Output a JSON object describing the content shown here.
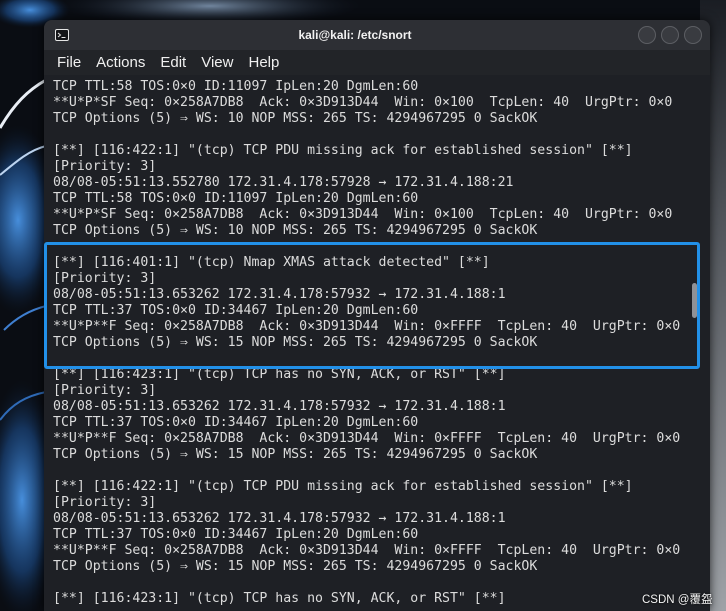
{
  "window": {
    "title": "kali@kali: /etc/snort"
  },
  "icons": {
    "window": "terminal-icon"
  },
  "menu": {
    "items": [
      "File",
      "Actions",
      "Edit",
      "View",
      "Help"
    ]
  },
  "terminal": {
    "lines": [
      "TCP TTL:58 TOS:0×0 ID:11097 IpLen:20 DgmLen:60",
      "**U*P*SF Seq: 0×258A7DB8  Ack: 0×3D913D44  Win: 0×100  TcpLen: 40  UrgPtr: 0×0",
      "TCP Options (5) ⇒ WS: 10 NOP MSS: 265 TS: 4294967295 0 SackOK",
      "",
      "[**] [116:422:1] \"(tcp) TCP PDU missing ack for established session\" [**]",
      "[Priority: 3]",
      "08/08-05:51:13.552780 172.31.4.178:57928 → 172.31.4.188:21",
      "TCP TTL:58 TOS:0×0 ID:11097 IpLen:20 DgmLen:60",
      "**U*P*SF Seq: 0×258A7DB8  Ack: 0×3D913D44  Win: 0×100  TcpLen: 40  UrgPtr: 0×0",
      "TCP Options (5) ⇒ WS: 10 NOP MSS: 265 TS: 4294967295 0 SackOK",
      "",
      "[**] [116:401:1] \"(tcp) Nmap XMAS attack detected\" [**]",
      "[Priority: 3]",
      "08/08-05:51:13.653262 172.31.4.178:57932 → 172.31.4.188:1",
      "TCP TTL:37 TOS:0×0 ID:34467 IpLen:20 DgmLen:60",
      "**U*P**F Seq: 0×258A7DB8  Ack: 0×3D913D44  Win: 0×FFFF  TcpLen: 40  UrgPtr: 0×0",
      "TCP Options (5) ⇒ WS: 15 NOP MSS: 265 TS: 4294967295 0 SackOK",
      "",
      "[**] [116:423:1] \"(tcp) TCP has no SYN, ACK, or RST\" [**]",
      "[Priority: 3]",
      "08/08-05:51:13.653262 172.31.4.178:57932 → 172.31.4.188:1",
      "TCP TTL:37 TOS:0×0 ID:34467 IpLen:20 DgmLen:60",
      "**U*P**F Seq: 0×258A7DB8  Ack: 0×3D913D44  Win: 0×FFFF  TcpLen: 40  UrgPtr: 0×0",
      "TCP Options (5) ⇒ WS: 15 NOP MSS: 265 TS: 4294967295 0 SackOK",
      "",
      "[**] [116:422:1] \"(tcp) TCP PDU missing ack for established session\" [**]",
      "[Priority: 3]",
      "08/08-05:51:13.653262 172.31.4.178:57932 → 172.31.4.188:1",
      "TCP TTL:37 TOS:0×0 ID:34467 IpLen:20 DgmLen:60",
      "**U*P**F Seq: 0×258A7DB8  Ack: 0×3D913D44  Win: 0×FFFF  TcpLen: 40  UrgPtr: 0×0",
      "TCP Options (5) ⇒ WS: 15 NOP MSS: 265 TS: 4294967295 0 SackOK",
      "",
      "[**] [116:423:1] \"(tcp) TCP has no SYN, ACK, or RST\" [**]"
    ],
    "scroll_position": 0.41
  },
  "watermark": "CSDN @覆盌",
  "colors": {
    "terminal_background": "#1e2025",
    "terminal_text": "#dcdcdc",
    "title_bar": "#2d2f34",
    "menu_bar": "#222428",
    "highlight_box": "#2290e8"
  }
}
